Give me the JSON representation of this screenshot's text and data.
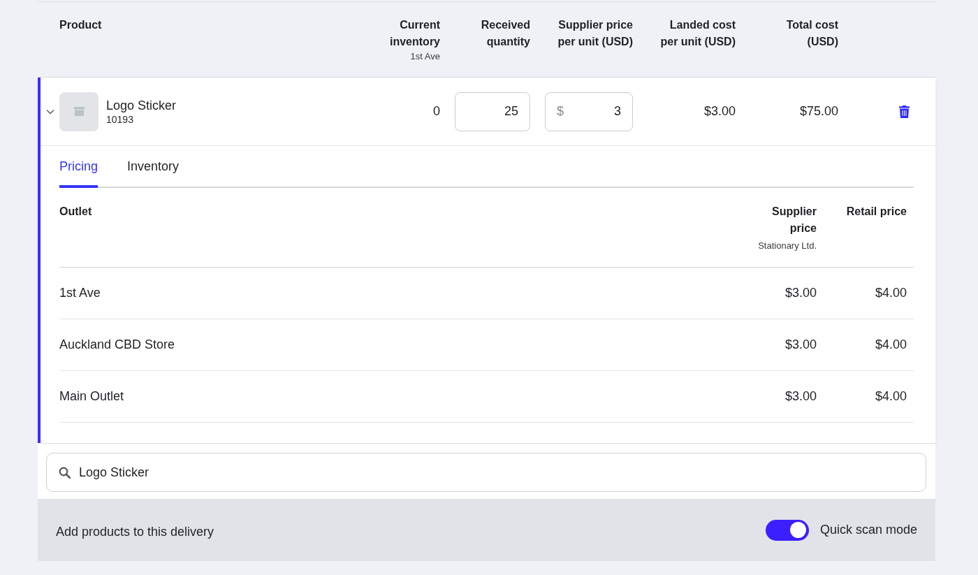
{
  "table": {
    "columns": [
      {
        "label": "Product"
      },
      {
        "label": "Current inventory",
        "sublabel": "1st Ave"
      },
      {
        "label": "Received quantity"
      },
      {
        "label": "Supplier price per unit (USD)"
      },
      {
        "label": "Landed cost per unit (USD)"
      },
      {
        "label": "Total cost (USD)"
      }
    ],
    "rows": [
      {
        "expanded": true,
        "name": "Logo Sticker",
        "sku": "10193",
        "current_inventory": "0",
        "received_quantity": "25",
        "supplier_price": {
          "prefix": "$",
          "value": "3"
        },
        "landed_cost": "$3.00",
        "total_cost": "$75.00",
        "details": {
          "tabs": [
            {
              "label": "Pricing",
              "selected": true
            },
            {
              "label": "Inventory",
              "selected": false
            }
          ],
          "columns": [
            {
              "label": "Outlet"
            },
            {
              "label": "Supplier price",
              "sublabel": "Stationary Ltd."
            },
            {
              "label": "Retail price"
            }
          ],
          "rows": [
            {
              "outlet": "1st Ave",
              "supplier_price": "$3.00",
              "retail_price": "$4.00"
            },
            {
              "outlet": "Auckland CBD Store",
              "supplier_price": "$3.00",
              "retail_price": "$4.00"
            },
            {
              "outlet": "Main Outlet",
              "supplier_price": "$3.00",
              "retail_price": "$4.00"
            }
          ]
        }
      }
    ]
  },
  "search": {
    "value": "Logo Sticker"
  },
  "footer": {
    "label": "Add products to this delivery",
    "quick_scan": {
      "label": "Quick scan mode",
      "on": true
    }
  }
}
